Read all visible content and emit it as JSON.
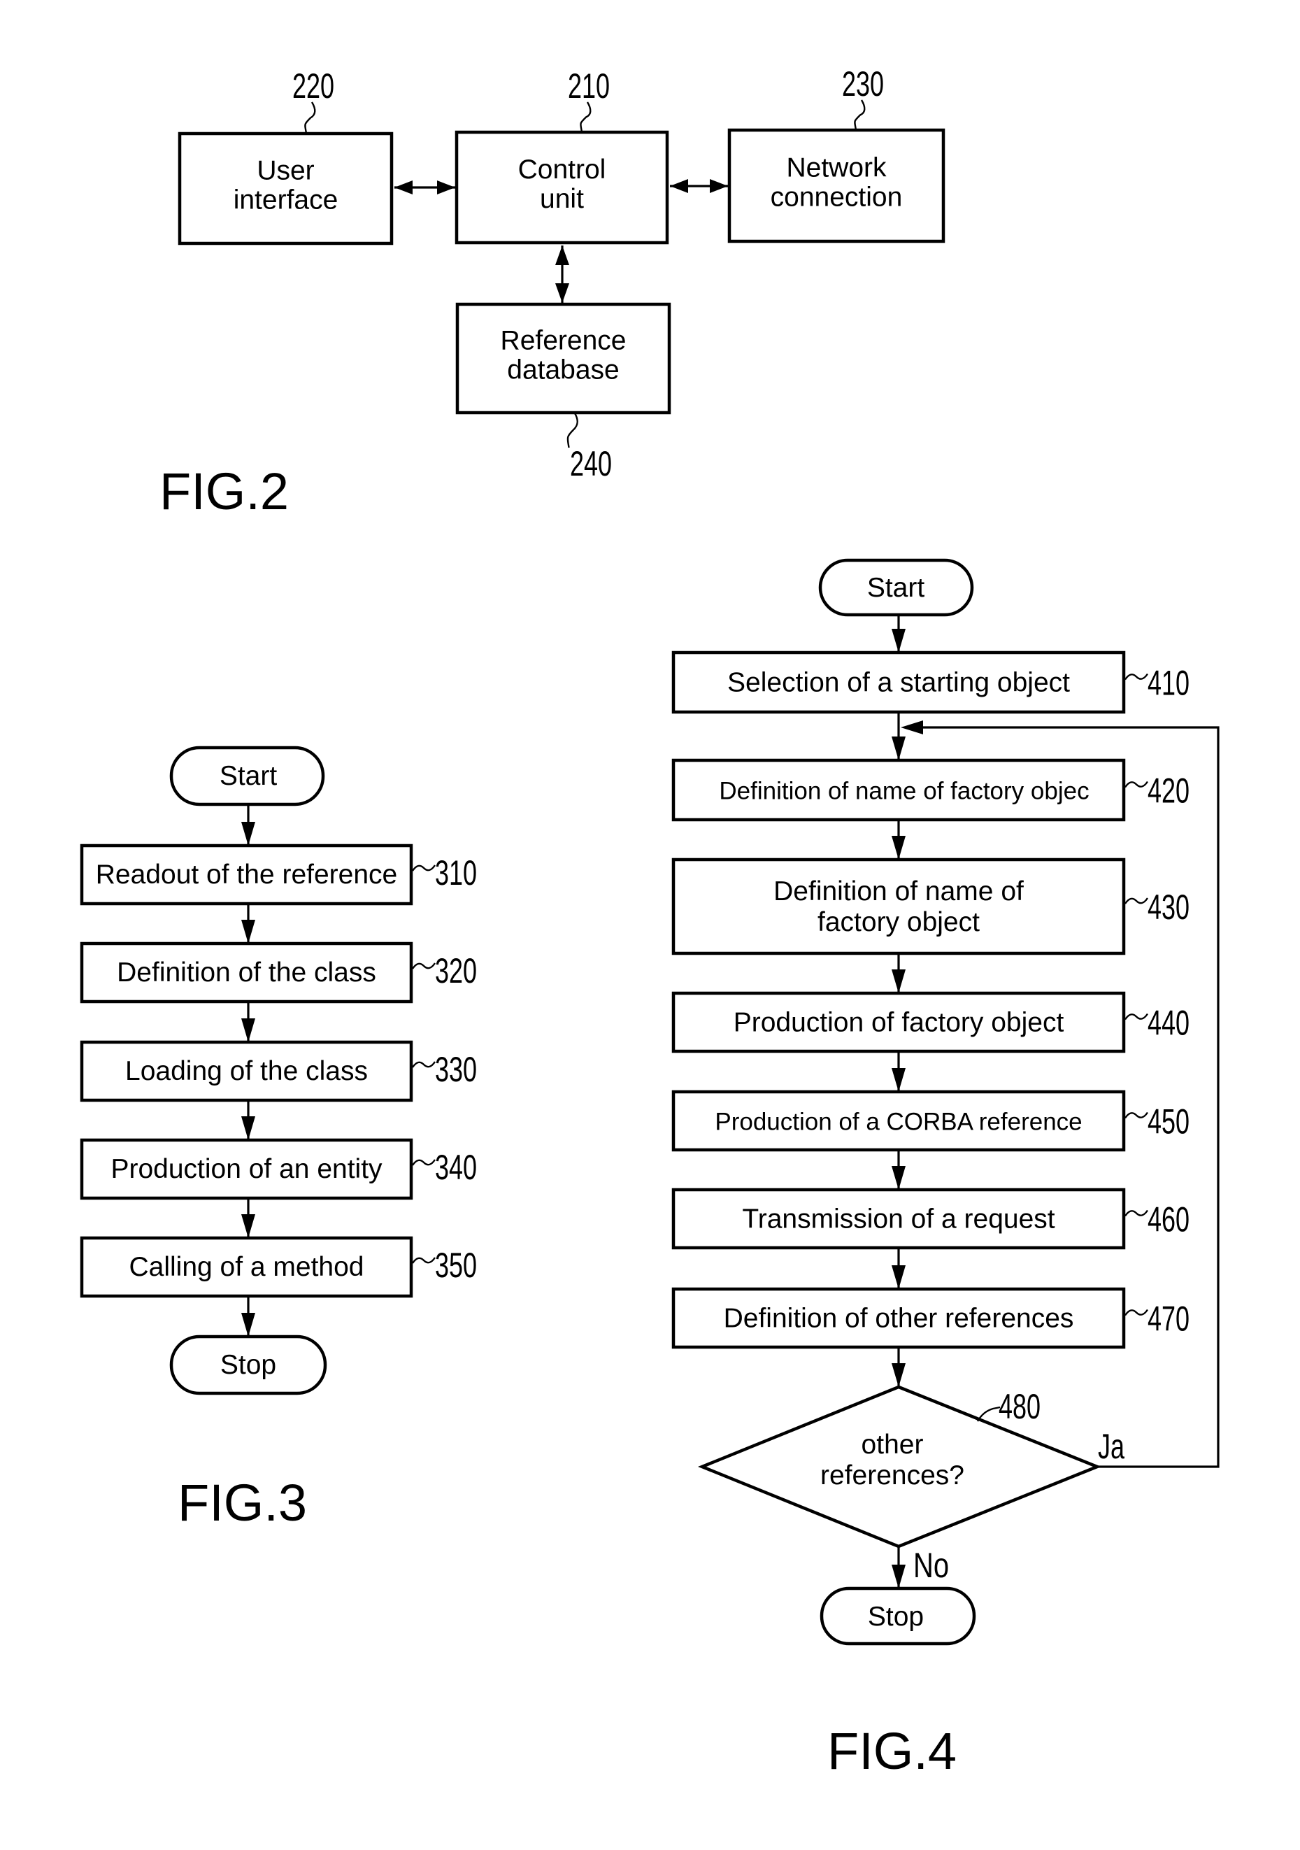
{
  "fig2": {
    "caption": "FIG.2",
    "blocks": [
      {
        "id": "control-unit",
        "ref": "210",
        "lines": [
          "Control",
          "unit"
        ]
      },
      {
        "id": "user-interface",
        "ref": "220",
        "lines": [
          "User",
          "interface"
        ]
      },
      {
        "id": "network-connection",
        "ref": "230",
        "lines": [
          "Network",
          "connection"
        ]
      },
      {
        "id": "reference-database",
        "ref": "240",
        "lines": [
          "Reference",
          "database"
        ]
      }
    ],
    "connections": [
      {
        "from": "user-interface",
        "to": "control-unit",
        "type": "bidirectional"
      },
      {
        "from": "control-unit",
        "to": "network-connection",
        "type": "bidirectional"
      },
      {
        "from": "control-unit",
        "to": "reference-database",
        "type": "bidirectional"
      }
    ]
  },
  "fig3": {
    "caption": "FIG.3",
    "start": "Start",
    "stop": "Stop",
    "steps": [
      {
        "ref": "310",
        "text": "Readout of the reference"
      },
      {
        "ref": "320",
        "text": "Definition of the class"
      },
      {
        "ref": "330",
        "text": "Loading of the class"
      },
      {
        "ref": "340",
        "text": "Production of an entity"
      },
      {
        "ref": "350",
        "text": "Calling of a method"
      }
    ]
  },
  "fig4": {
    "caption": "FIG.4",
    "start": "Start",
    "stop": "Stop",
    "steps": [
      {
        "ref": "410",
        "lines": [
          "Selection of a starting object"
        ]
      },
      {
        "ref": "420",
        "lines": [
          "Definition of name of factory objec"
        ]
      },
      {
        "ref": "430",
        "lines": [
          "Definition of name of",
          "factory object"
        ]
      },
      {
        "ref": "440",
        "lines": [
          "Production of factory object"
        ]
      },
      {
        "ref": "450",
        "lines": [
          "Production of a CORBA reference"
        ]
      },
      {
        "ref": "460",
        "lines": [
          "Transmission of a request"
        ]
      },
      {
        "ref": "470",
        "lines": [
          "Definition of other references"
        ]
      }
    ],
    "decision": {
      "ref": "480",
      "lines": [
        "other",
        "references?"
      ],
      "yes_label": "Ja",
      "no_label": "No"
    }
  }
}
